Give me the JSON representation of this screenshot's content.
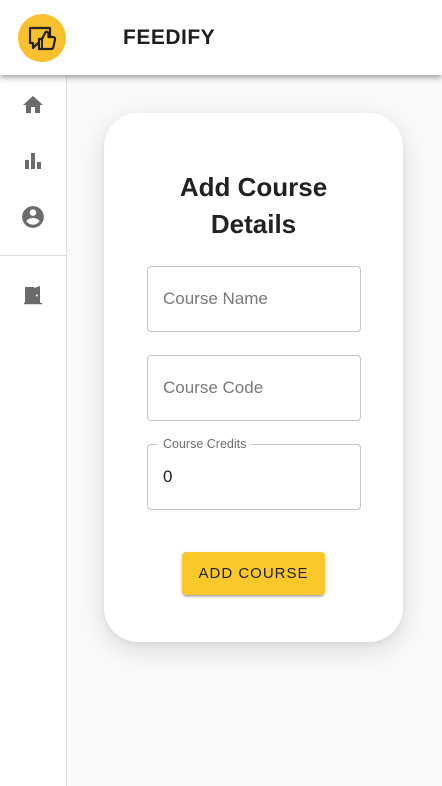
{
  "app": {
    "name": "FEEDIFY",
    "logo_icon": "thumbs-up-chat-icon",
    "accent_color": "#fbc82b"
  },
  "sidebar": {
    "items": [
      {
        "icon": "home-icon"
      },
      {
        "icon": "bar-chart-icon"
      },
      {
        "icon": "account-circle-icon"
      },
      {
        "icon": "logout-door-icon"
      }
    ]
  },
  "form": {
    "title": "Add Course\nDetails",
    "course_name": {
      "placeholder": "Course Name",
      "value": ""
    },
    "course_code": {
      "placeholder": "Course Code",
      "value": ""
    },
    "course_credits": {
      "label": "Course Credits",
      "value": "0"
    },
    "submit_label": "ADD COURSE"
  }
}
